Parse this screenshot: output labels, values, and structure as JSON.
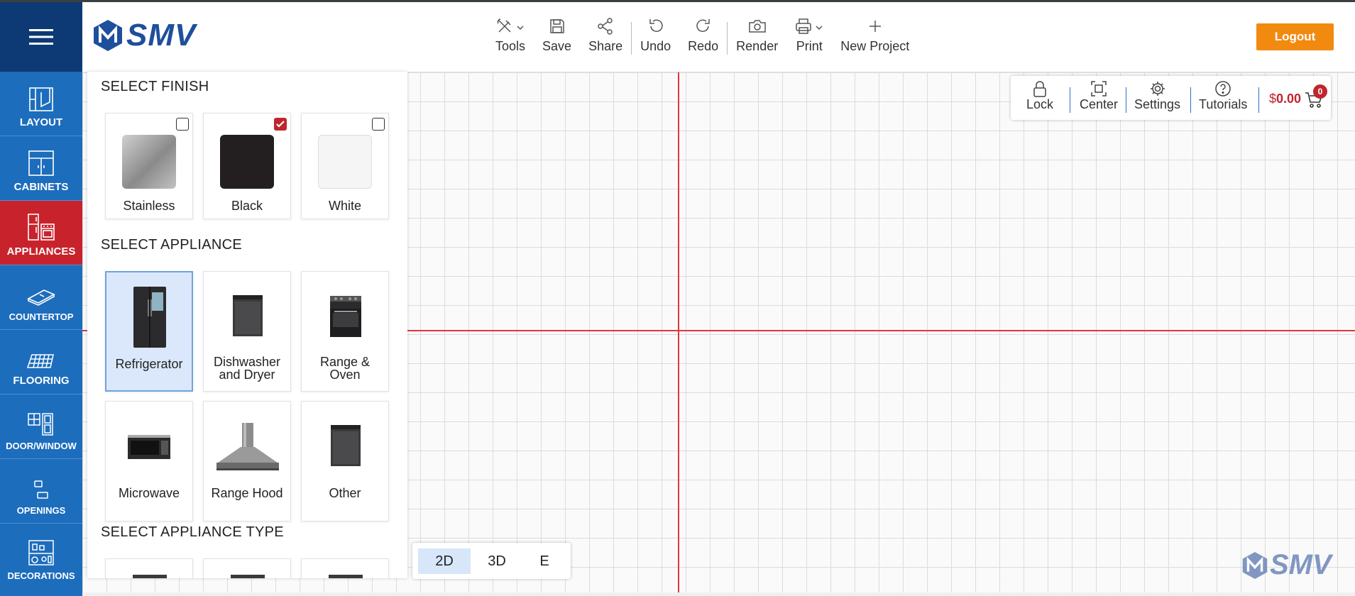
{
  "brand": {
    "name": "SMV"
  },
  "sidebar": {
    "items": [
      {
        "label": "LAYOUT",
        "icon": "layout-icon"
      },
      {
        "label": "CABINETS",
        "icon": "cabinet-icon"
      },
      {
        "label": "APPLIANCES",
        "icon": "appliance-icon",
        "active": true
      },
      {
        "label": "COUNTERTOP",
        "icon": "countertop-icon"
      },
      {
        "label": "FLOORING",
        "icon": "flooring-icon"
      },
      {
        "label": "DOOR/WINDOW",
        "icon": "door-window-icon"
      },
      {
        "label": "OPENINGS",
        "icon": "openings-icon"
      },
      {
        "label": "DECORATIONS",
        "icon": "decorations-icon"
      }
    ]
  },
  "toolbar": {
    "tools": "Tools",
    "save": "Save",
    "share": "Share",
    "undo": "Undo",
    "redo": "Redo",
    "render": "Render",
    "print": "Print",
    "new_project": "New Project"
  },
  "logout": "Logout",
  "panel": {
    "finish_title": "SELECT FINISH",
    "finishes": [
      {
        "label": "Stainless",
        "checked": false,
        "color": "#a9a9a9"
      },
      {
        "label": "Black",
        "checked": true,
        "color": "#231f20"
      },
      {
        "label": "White",
        "checked": false,
        "color": "#f5f5f5"
      }
    ],
    "appliance_title": "SELECT APPLIANCE",
    "appliances": [
      {
        "label": "Refrigerator",
        "selected": true
      },
      {
        "label_line1": "Dishwasher",
        "label_line2": "and Dryer"
      },
      {
        "label_line1": "Range &",
        "label_line2": "Oven"
      },
      {
        "label": "Microwave"
      },
      {
        "label": "Range Hood"
      },
      {
        "label": "Other"
      }
    ],
    "type_title": "SELECT APPLIANCE TYPE"
  },
  "view_toggle": {
    "v2d": "2D",
    "v3d": "3D",
    "ve": "E",
    "active": "2D"
  },
  "utility": {
    "lock": "Lock",
    "center": "Center",
    "settings": "Settings",
    "tutorials": "Tutorials",
    "currency": "$",
    "price": "0.00",
    "cart_count": "0"
  },
  "colors": {
    "accent_blue": "#1d6dbd",
    "active_red": "#c8232c",
    "logout_orange": "#f28a10",
    "axis_red": "#e0363d"
  }
}
